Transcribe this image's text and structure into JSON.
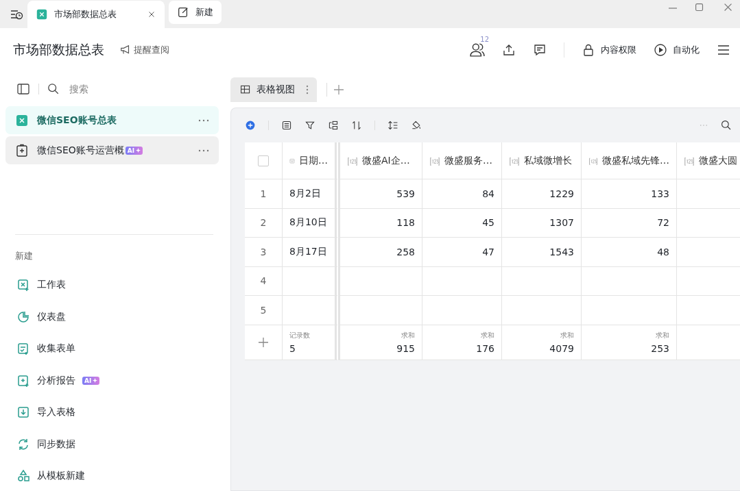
{
  "window": {
    "tabs": [
      {
        "title": "市场部数据总表",
        "selected": true
      },
      {
        "title": "新建",
        "selected": false
      }
    ]
  },
  "header": {
    "title": "市场部数据总表",
    "remind": "提醒查阅",
    "members_count": "12",
    "permission": "内容权限",
    "automation": "自动化"
  },
  "sidebar": {
    "search": {
      "placeholder": "搜索"
    },
    "items": [
      {
        "label": "微信SEO账号总表",
        "kind": "sheet",
        "selected": true
      },
      {
        "label": "微信SEO账号运营概",
        "kind": "report",
        "selected": false,
        "badge": "AI"
      }
    ],
    "new_section": {
      "title": "新建",
      "items": [
        {
          "label": "工作表",
          "kind": "sheet"
        },
        {
          "label": "仪表盘",
          "kind": "dashboard"
        },
        {
          "label": "收集表单",
          "kind": "form"
        },
        {
          "label": "分析报告",
          "kind": "report",
          "badge": "AI"
        },
        {
          "label": "导入表格",
          "kind": "import"
        },
        {
          "label": "同步数据",
          "kind": "sync"
        },
        {
          "label": "从模板新建",
          "kind": "template"
        }
      ]
    }
  },
  "views": [
    {
      "label": "表格视图",
      "selected": true
    }
  ],
  "table": {
    "select_all": {
      "checked": false
    },
    "columns": [
      {
        "label": "日期…",
        "kind": "date"
      },
      {
        "label": "微盛AI企…",
        "kind": "number"
      },
      {
        "label": "微盛服务…",
        "kind": "number"
      },
      {
        "label": "私域微增长",
        "kind": "number"
      },
      {
        "label": "微盛私域先锋…",
        "kind": "number"
      },
      {
        "label": "微盛大圆",
        "kind": "number"
      }
    ],
    "rows": [
      {
        "index": "1",
        "cells": [
          "8月2日",
          "539",
          "84",
          "1229",
          "133"
        ]
      },
      {
        "index": "2",
        "cells": [
          "8月10日",
          "118",
          "45",
          "1307",
          "72"
        ]
      },
      {
        "index": "3",
        "cells": [
          "8月17日",
          "258",
          "47",
          "1543",
          "48"
        ]
      },
      {
        "index": "4",
        "cells": []
      },
      {
        "index": "5",
        "cells": []
      }
    ],
    "footer": [
      {
        "label": "记录数",
        "value": "5"
      },
      {
        "label": "求和",
        "value": "915"
      },
      {
        "label": "求和",
        "value": "176"
      },
      {
        "label": "求和",
        "value": "4079"
      },
      {
        "label": "求和",
        "value": "253"
      }
    ]
  }
}
